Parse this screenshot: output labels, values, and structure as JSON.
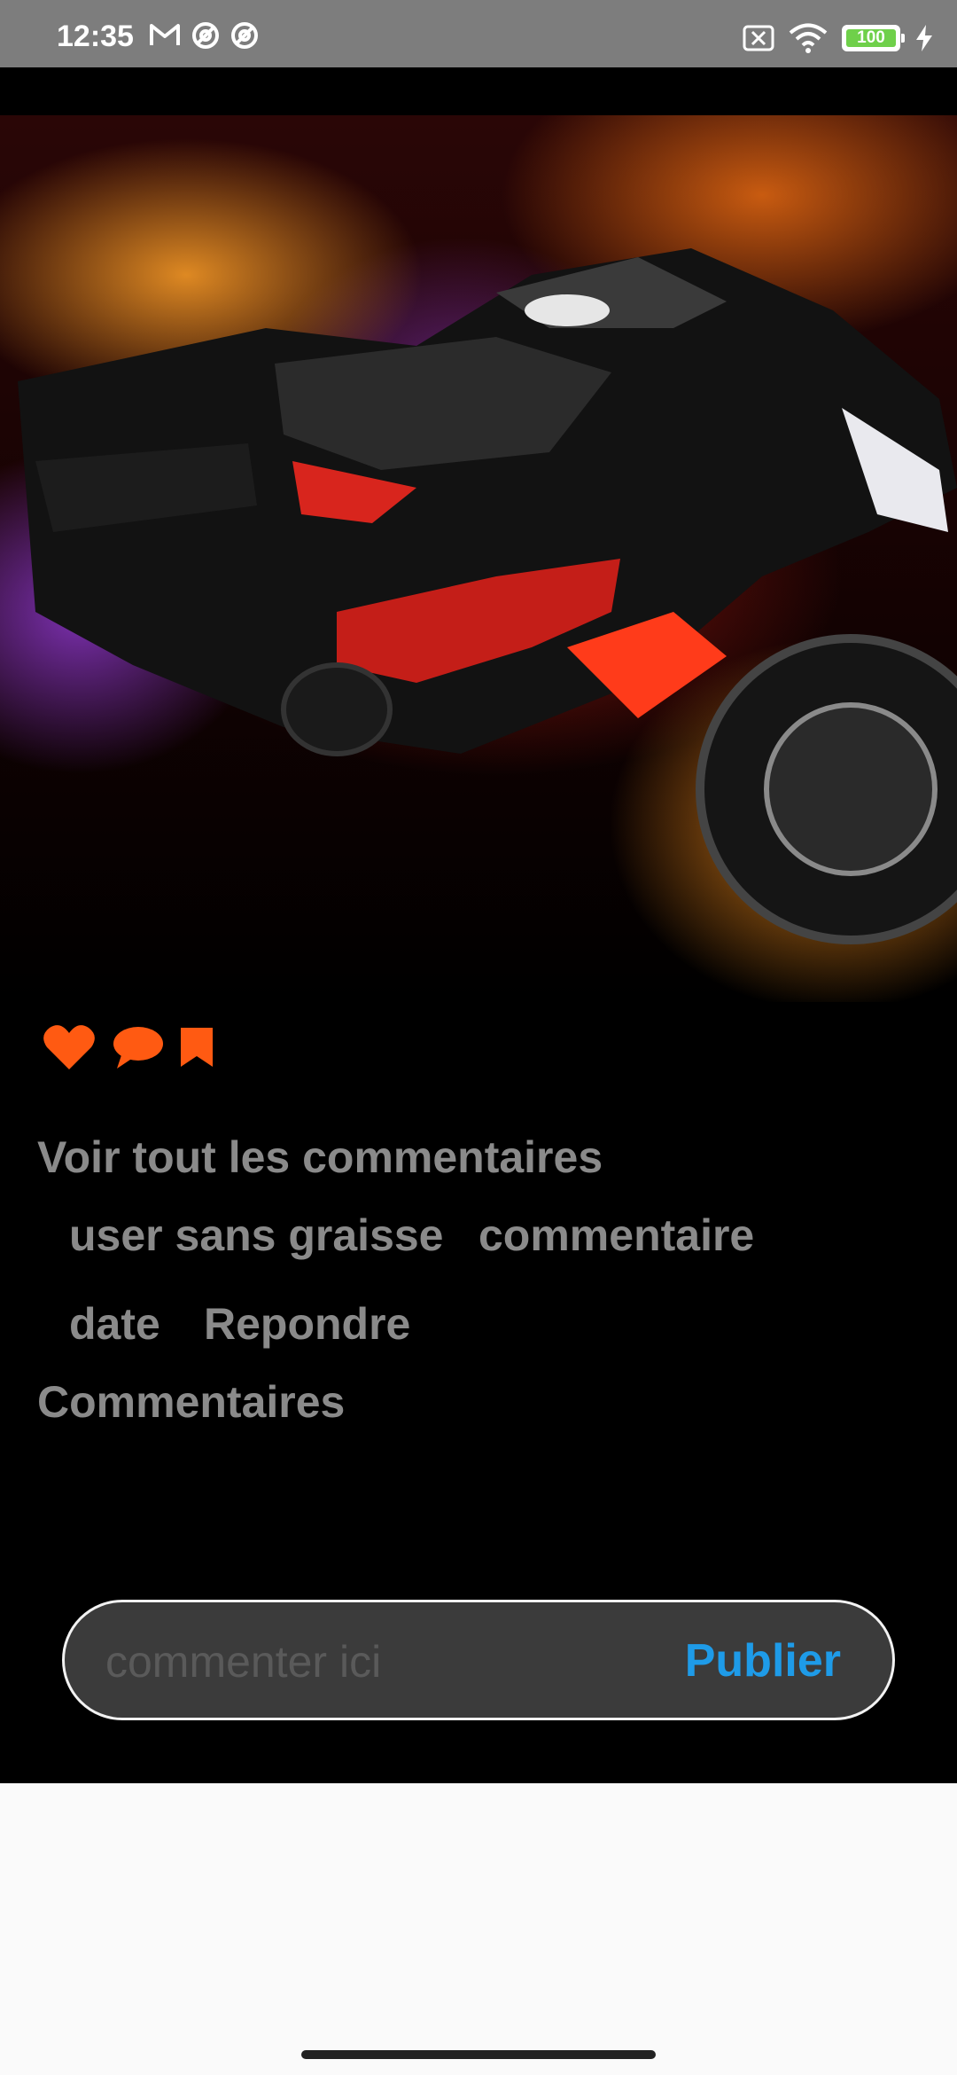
{
  "status_bar": {
    "time": "12:35",
    "battery": "100",
    "left_icons": [
      "gmail-icon",
      "at-sign-icon",
      "at-sign-icon"
    ],
    "right_icons": [
      "no-sim-icon",
      "wifi-icon",
      "battery-icon",
      "charging-icon"
    ]
  },
  "post": {
    "image": "motorcycle-in-flames",
    "actions": [
      "heart-icon",
      "comment-icon",
      "bookmark-icon"
    ],
    "accent_color": "#ff5a12",
    "see_all_comments": "Voir tout les commentaires",
    "comment": {
      "user": "user sans graisse",
      "text": "commentaire",
      "date": "date",
      "reply": "Repondre"
    },
    "comments_label": "Commentaires"
  },
  "composer": {
    "placeholder": "commenter ici",
    "publish_label": "Publier",
    "publish_color": "#1e9be8"
  }
}
